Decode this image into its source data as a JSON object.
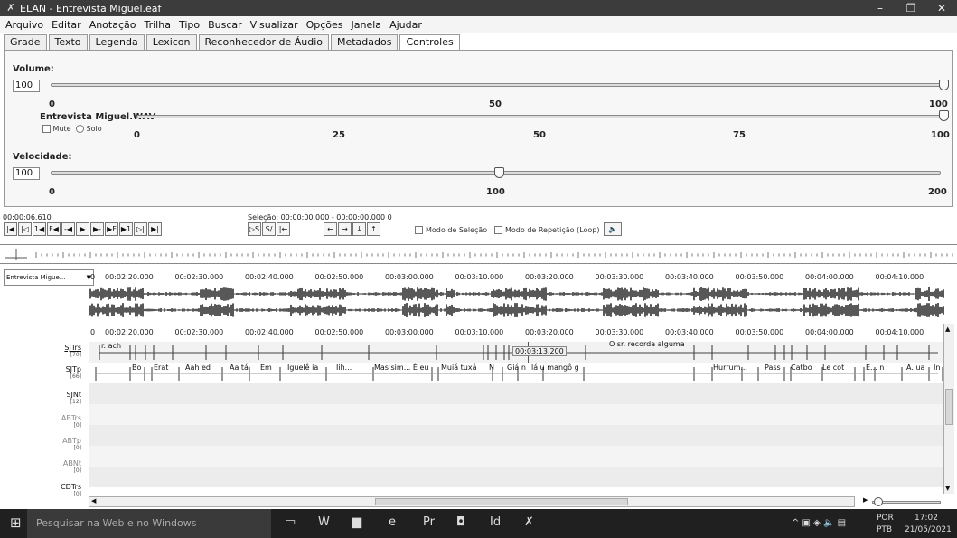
{
  "window": {
    "title": "ELAN - Entrevista Miguel.eaf"
  },
  "menu": [
    "Arquivo",
    "Editar",
    "Anotação",
    "Trilha",
    "Tipo",
    "Buscar",
    "Visualizar",
    "Opções",
    "Janela",
    "Ajudar"
  ],
  "tabs": [
    "Grade",
    "Texto",
    "Legenda",
    "Lexicon",
    "Reconhecedor de Áudio",
    "Metadados",
    "Controles"
  ],
  "controls": {
    "volume_label": "Volume:",
    "volume_value": "100",
    "volume_ticks": [
      "0",
      "50",
      "100"
    ],
    "volume_level": 1.0,
    "file_label": "Entrevista Miguel.WAV",
    "file_ticks": [
      "0",
      "25",
      "50",
      "75",
      "100"
    ],
    "file_level": 1.0,
    "mute_label": "Mute",
    "solo_label": "Solo",
    "speed_label": "Velocidade:",
    "speed_value": "100",
    "speed_ticks": [
      "0",
      "100",
      "200"
    ],
    "speed_level": 0.5
  },
  "player": {
    "time": "00:00:06.610",
    "selection": "Seleção: 00:00:00.000 - 00:00:00.000  0",
    "selection_mode": "Modo de Seleção",
    "loop_mode": "Modo de Repetição (Loop)"
  },
  "wave": {
    "selector": "Entrevista Migue...",
    "times": [
      "0",
      "00:02:20.000",
      "00:02:30.000",
      "00:02:40.000",
      "00:02:50.000",
      "00:03:00.000",
      "00:03:10.000",
      "00:03:20.000",
      "00:03:30.000",
      "00:03:40.000",
      "00:03:50.000",
      "00:04:00.000",
      "00:04:10.000"
    ]
  },
  "timeline": {
    "times": [
      "0",
      "00:02:20.000",
      "00:02:30.000",
      "00:02:40.000",
      "00:02:50.000",
      "00:03:00.000",
      "00:03:10.000",
      "00:03:20.000",
      "00:03:30.000",
      "00:03:40.000",
      "00:03:50.000",
      "00:04:00.000",
      "00:04:10.000"
    ],
    "crosshair_time": "00:03:13.200"
  },
  "tiers": [
    {
      "name": "SJTrs",
      "count": "[70]"
    },
    {
      "name": "SJTp",
      "count": "[66]"
    },
    {
      "name": "SJNt",
      "count": "[12]"
    },
    {
      "name": "ABTrs",
      "count": "[0]"
    },
    {
      "name": "ABTp",
      "count": "[0]"
    },
    {
      "name": "ABNt",
      "count": "[0]"
    },
    {
      "name": "CDTrs",
      "count": "[0]"
    }
  ],
  "annotations_trs": [
    "r. ach",
    "O sr. recorda alguma"
  ],
  "annotations_tp": [
    "Bo",
    "Erat",
    "Aah ed",
    "Aa tá",
    "Em",
    "Iguelê ia",
    "Iih...",
    "Mas sim... É eu",
    "Muiá tuxá",
    "N",
    "Giá n",
    "lá u mangô g",
    "Hurrum...",
    "Pass",
    "Catbo",
    "Le cot",
    "É... n",
    "A. ua",
    "In"
  ],
  "taskbar": {
    "search": "Pesquisar na Web e no Windows",
    "lang1": "POR",
    "lang2": "PTB",
    "clock": "17:02",
    "date": "21/05/2021"
  }
}
